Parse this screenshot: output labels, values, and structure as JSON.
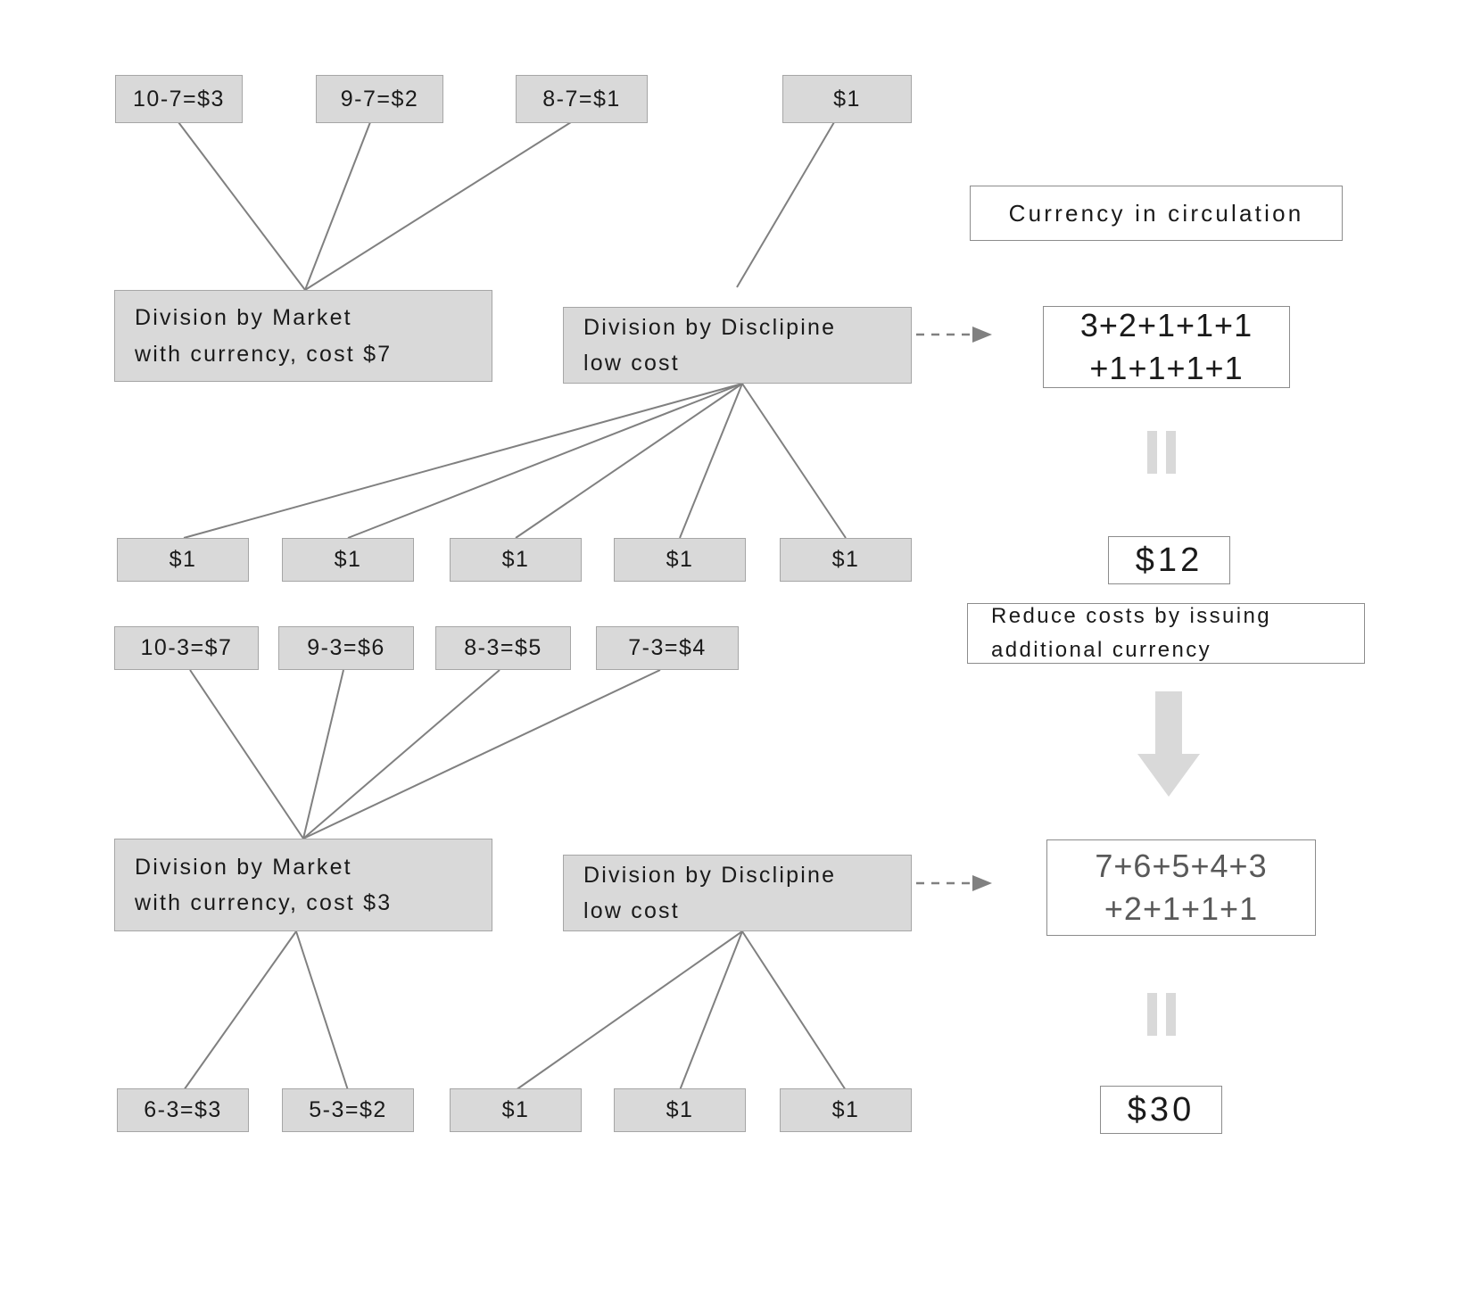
{
  "diagram": {
    "title": "Currency circulation cost-reduction flow",
    "colors": {
      "node_fill": "#d9d9d9",
      "node_border": "#a6a6a6",
      "plain_border": "#8c8c8c",
      "line": "#808080",
      "equals_gray": "#d9d9d9",
      "arrow_gray": "#d9d9d9",
      "text_dark": "#1a1a1a",
      "text_gray": "#595959"
    },
    "top_row": [
      {
        "id": "t1",
        "label": "10-7=$3"
      },
      {
        "id": "t2",
        "label": "9-7=$2"
      },
      {
        "id": "t3",
        "label": "8-7=$1"
      },
      {
        "id": "t4",
        "label": "$1"
      }
    ],
    "hub_row_1": [
      {
        "id": "h1",
        "label": "Division by Market\nwith currency, cost $7"
      },
      {
        "id": "h2",
        "label": "Division by Disclipine\nlow cost"
      }
    ],
    "mid_ones_row": [
      {
        "id": "m1",
        "label": "$1"
      },
      {
        "id": "m2",
        "label": "$1"
      },
      {
        "id": "m3",
        "label": "$1"
      },
      {
        "id": "m4",
        "label": "$1"
      },
      {
        "id": "m5",
        "label": "$1"
      }
    ],
    "second_row": [
      {
        "id": "s1",
        "label": "10-3=$7"
      },
      {
        "id": "s2",
        "label": "9-3=$6"
      },
      {
        "id": "s3",
        "label": "8-3=$5"
      },
      {
        "id": "s4",
        "label": "7-3=$4"
      }
    ],
    "hub_row_2": [
      {
        "id": "h3",
        "label": "Division by Market\nwith currency, cost $3"
      },
      {
        "id": "h4",
        "label": "Division by Disclipine\nlow cost"
      }
    ],
    "bottom_row": [
      {
        "id": "b1",
        "label": "6-3=$3"
      },
      {
        "id": "b2",
        "label": "5-3=$2"
      },
      {
        "id": "b3",
        "label": "$1"
      },
      {
        "id": "b4",
        "label": "$1"
      },
      {
        "id": "b5",
        "label": "$1"
      }
    ],
    "right_panel": {
      "header_label": "Currency in circulation",
      "formula_top_line1": "3+2+1+1+1",
      "formula_top_line2": "+1+1+1+1",
      "equals_1": "=",
      "total_1": "$12",
      "reduce_label": "Reduce costs by issuing\nadditional currency",
      "formula_bottom_line1": "7+6+5+4+3",
      "formula_bottom_line2": "+2+1+1+1",
      "equals_2": "=",
      "total_2": "$30"
    }
  }
}
